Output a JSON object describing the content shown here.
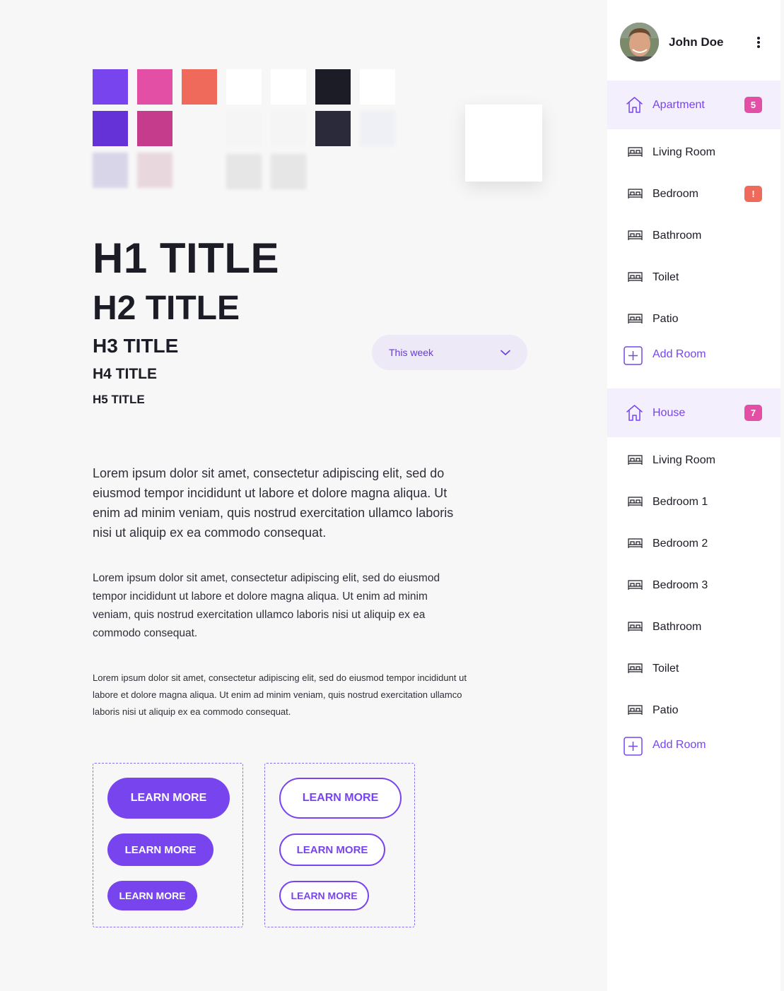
{
  "palette": {
    "purple": "#7844ee",
    "purple_dark": "#6432d6",
    "purple_light": "#d8d5e8",
    "pink": "#e24fa5",
    "pink_dark": "#c43c8b",
    "pink_light": "#e8d8de",
    "coral": "#ef6a5b",
    "white": "#ffffff",
    "off_white": "#f5f5f5",
    "grey_light": "#e6e6e6",
    "black": "#1b1c25",
    "navy": "#2a2a3a",
    "lavender_white": "#eff0f5"
  },
  "titles": {
    "h1": "H1 TITLE",
    "h2": "H2 TITLE",
    "h3": "H3 TITLE",
    "h4": "H4 TITLE",
    "h5": "H5 TITLE"
  },
  "dropdown": {
    "value": "This week",
    "icon": "chevron-down-icon"
  },
  "paragraphs": {
    "large": "Lorem ipsum dolor sit amet, consectetur adipiscing elit, sed do eiusmod tempor incididunt ut labore et dolore magna aliqua. Ut enim ad minim veniam, quis nostrud exercitation ullamco laboris nisi ut aliquip ex ea commodo consequat.",
    "medium": "Lorem ipsum dolor sit amet, consectetur adipiscing elit, sed do eiusmod tempor incididunt ut labore et dolore magna aliqua. Ut enim ad minim veniam, quis nostrud exercitation ullamco laboris nisi ut aliquip ex ea commodo consequat.",
    "small": "Lorem ipsum dolor sit amet, consectetur adipiscing elit, sed do eiusmod tempor incididunt ut labore et dolore magna aliqua. Ut enim ad minim veniam, quis nostrud exercitation ullamco laboris nisi ut aliquip ex ea commodo consequat."
  },
  "buttons": {
    "filled_lg": "LEARN MORE",
    "filled_md": "LEARN MORE",
    "filled_sm": "LEARN MORE",
    "outline_lg": "LEARN MORE",
    "outline_md": "LEARN MORE",
    "outline_sm": "LEARN MORE"
  },
  "sidebar": {
    "user": {
      "name": "John Doe",
      "menu_icon": "more-vertical-icon"
    },
    "groups": [
      {
        "label": "Apartment",
        "icon": "home-icon",
        "badge": "5",
        "rooms": [
          "Living Room",
          "Bedroom",
          "Bathroom",
          "Toilet",
          "Patio"
        ],
        "room_badges": {
          "Bedroom": "!"
        },
        "add_label": "Add Room"
      },
      {
        "label": "House",
        "icon": "home-icon",
        "badge": "7",
        "rooms": [
          "Living Room",
          "Bedroom 1",
          "Bedroom 2",
          "Bedroom 3",
          "Bathroom",
          "Toilet",
          "Patio"
        ],
        "add_label": "Add Room"
      }
    ]
  }
}
